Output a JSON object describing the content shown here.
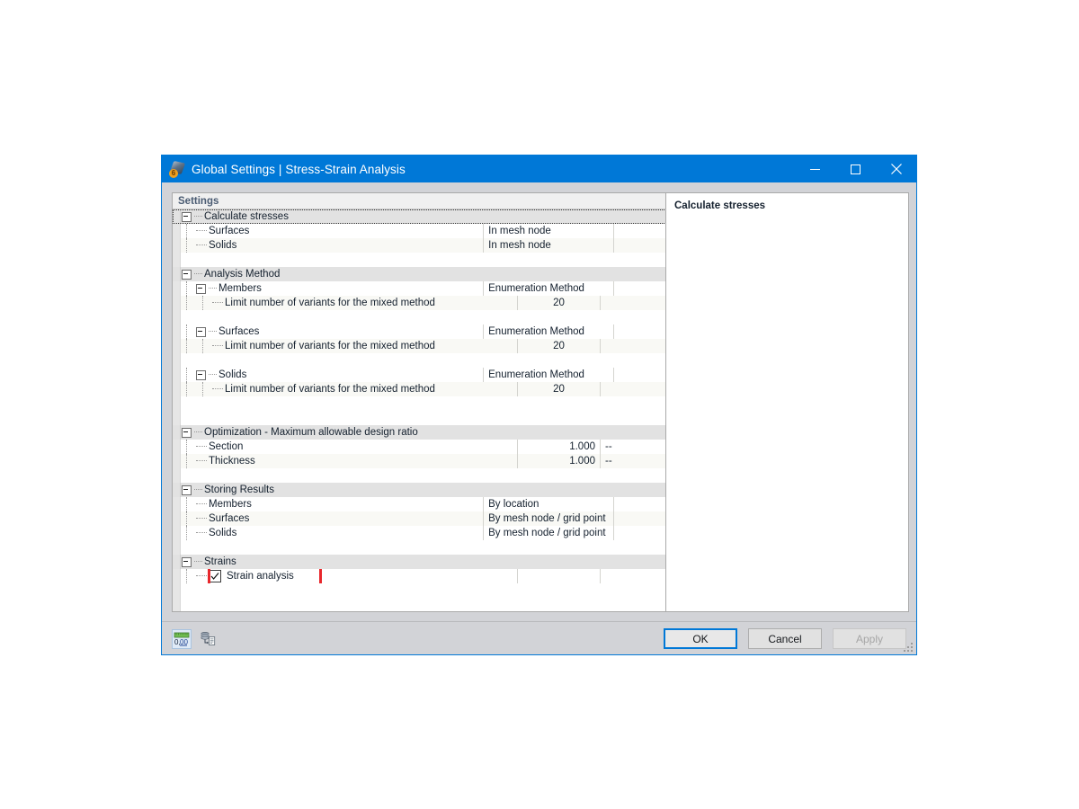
{
  "window": {
    "title": "Global Settings | Stress-Strain Analysis",
    "icon": "rfem-app-icon",
    "badge": "6",
    "minimize_label": "–",
    "maximize_label": "□",
    "close_label": "✕",
    "accent_color": "#0078d7"
  },
  "tree": {
    "header": "Settings",
    "rows": [
      {
        "kind": "group",
        "label": "Calculate stresses",
        "value": "",
        "unit": "",
        "selected": true,
        "indent": 0
      },
      {
        "kind": "leaf",
        "label": "Surfaces",
        "value": "In mesh node",
        "unit": "",
        "indent": 1,
        "align": "left",
        "wide": true
      },
      {
        "kind": "leaf",
        "label": "Solids",
        "value": "In mesh node",
        "unit": "",
        "indent": 1,
        "align": "left",
        "wide": true
      },
      {
        "kind": "spacer",
        "label": "",
        "value": "",
        "unit": ""
      },
      {
        "kind": "group",
        "label": "Analysis Method",
        "value": "",
        "unit": "",
        "indent": 0
      },
      {
        "kind": "node",
        "label": "Members",
        "value": "Enumeration Method",
        "unit": "",
        "indent": 1,
        "align": "left",
        "wide": true
      },
      {
        "kind": "leaf",
        "label": "Limit number of variants for the mixed method",
        "value": "20",
        "unit": "",
        "indent": 2,
        "align": "center"
      },
      {
        "kind": "spacer",
        "label": "",
        "value": "",
        "unit": ""
      },
      {
        "kind": "node",
        "label": "Surfaces",
        "value": "Enumeration Method",
        "unit": "",
        "indent": 1,
        "align": "left",
        "wide": true
      },
      {
        "kind": "leaf",
        "label": "Limit number of variants for the mixed method",
        "value": "20",
        "unit": "",
        "indent": 2,
        "align": "center"
      },
      {
        "kind": "spacer",
        "label": "",
        "value": "",
        "unit": ""
      },
      {
        "kind": "node",
        "label": "Solids",
        "value": "Enumeration Method",
        "unit": "",
        "indent": 1,
        "align": "left",
        "wide": true
      },
      {
        "kind": "leaf",
        "label": "Limit number of variants for the mixed method",
        "value": "20",
        "unit": "",
        "indent": 2,
        "align": "center"
      },
      {
        "kind": "spacer",
        "label": "",
        "value": "",
        "unit": ""
      },
      {
        "kind": "spacer",
        "label": "",
        "value": "",
        "unit": ""
      },
      {
        "kind": "group",
        "label": "Optimization - Maximum allowable design ratio",
        "value": "",
        "unit": "",
        "indent": 0
      },
      {
        "kind": "leaf",
        "label": "Section",
        "value": "1.000",
        "unit": "--",
        "indent": 1,
        "align": "right"
      },
      {
        "kind": "leaf",
        "label": "Thickness",
        "value": "1.000",
        "unit": "--",
        "indent": 1,
        "align": "right"
      },
      {
        "kind": "spacer",
        "label": "",
        "value": "",
        "unit": ""
      },
      {
        "kind": "group",
        "label": "Storing Results",
        "value": "",
        "unit": "",
        "indent": 0
      },
      {
        "kind": "leaf",
        "label": "Members",
        "value": "By location",
        "unit": "",
        "indent": 1,
        "align": "left",
        "wide": true
      },
      {
        "kind": "leaf",
        "label": "Surfaces",
        "value": "By mesh node / grid point",
        "unit": "",
        "indent": 1,
        "align": "left",
        "wide": true
      },
      {
        "kind": "leaf",
        "label": "Solids",
        "value": "By mesh node / grid point",
        "unit": "",
        "indent": 1,
        "align": "left",
        "wide": true
      },
      {
        "kind": "spacer",
        "label": "",
        "value": "",
        "unit": ""
      },
      {
        "kind": "group",
        "label": "Strains",
        "value": "",
        "unit": "",
        "indent": 0
      },
      {
        "kind": "check",
        "label": "Strain analysis",
        "value": "",
        "unit": "",
        "indent": 1,
        "checked": true,
        "highlighted": true
      },
      {
        "kind": "spacer",
        "label": "",
        "value": "",
        "unit": ""
      },
      {
        "kind": "spacer",
        "label": "",
        "value": "",
        "unit": ""
      }
    ]
  },
  "description": {
    "title": "Calculate stresses"
  },
  "toolbar": {
    "decimals_icon": "decimal-places-icon",
    "decimals_label": "0,00",
    "export_icon": "database-export-icon"
  },
  "footer": {
    "ok_label": "OK",
    "cancel_label": "Cancel",
    "apply_label": "Apply",
    "apply_enabled": false
  },
  "highlight": {
    "color": "#e8272c"
  }
}
